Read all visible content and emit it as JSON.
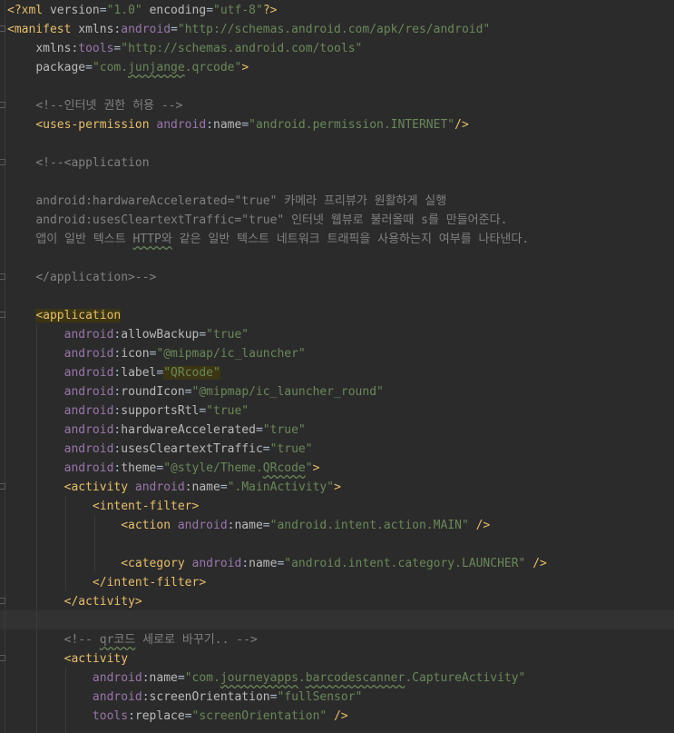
{
  "editor": {
    "language": "xml",
    "colors": {
      "background": "#2b2b2b",
      "tag": "#e8bf6a",
      "attribute": "#bababa",
      "namespace": "#9876aa",
      "string": "#6a8759",
      "comment": "#808080",
      "text": "#a9b7c6"
    },
    "lines": [
      [
        [
          "t-tag",
          "<?xml "
        ],
        [
          "t-attr",
          "version"
        ],
        [
          "t-plain",
          "="
        ],
        [
          "t-str",
          "\"1.0\""
        ],
        [
          "t-plain",
          " "
        ],
        [
          "t-attr",
          "encoding"
        ],
        [
          "t-plain",
          "="
        ],
        [
          "t-str",
          "\"utf-8\""
        ],
        [
          "t-tag",
          "?>"
        ]
      ],
      [
        [
          "t-tag",
          "<manifest "
        ],
        [
          "t-attr",
          "xmlns:"
        ],
        [
          "t-ns",
          "android"
        ],
        [
          "t-plain",
          "="
        ],
        [
          "t-str",
          "\"http://schemas.android.com/apk/res/android\""
        ]
      ],
      [
        [
          "t-plain",
          "    "
        ],
        [
          "t-attr",
          "xmlns:"
        ],
        [
          "t-ns",
          "tools"
        ],
        [
          "t-plain",
          "="
        ],
        [
          "t-str",
          "\"http://schemas.android.com/tools\""
        ]
      ],
      [
        [
          "t-plain",
          "    "
        ],
        [
          "t-attr",
          "package"
        ],
        [
          "t-plain",
          "="
        ],
        [
          "t-str",
          "\"com."
        ],
        [
          "t-str t-squig",
          "junjange"
        ],
        [
          "t-str",
          ".qrcode\""
        ],
        [
          "t-tag",
          ">"
        ]
      ],
      [],
      [
        [
          "t-plain",
          "    "
        ],
        [
          "t-cmt",
          "<!--인터넷 권한 허용 -->"
        ]
      ],
      [
        [
          "t-plain",
          "    "
        ],
        [
          "t-tag",
          "<uses-permission "
        ],
        [
          "t-ns",
          "android"
        ],
        [
          "t-plain",
          ":"
        ],
        [
          "t-attr",
          "name"
        ],
        [
          "t-plain",
          "="
        ],
        [
          "t-str",
          "\"android.permission.INTERNET\""
        ],
        [
          "t-tag",
          "/>"
        ]
      ],
      [],
      [
        [
          "t-plain",
          "    "
        ],
        [
          "t-cmt",
          "<!--<application"
        ]
      ],
      [],
      [
        [
          "t-plain",
          "    "
        ],
        [
          "t-cmt",
          "android:hardwareAccelerated=\"true\" 카메라 프리뷰가 원활하게 실행"
        ]
      ],
      [
        [
          "t-plain",
          "    "
        ],
        [
          "t-cmt",
          "android:usesCleartextTraffic=\"true\" 인터넷 웹뷰로 불러올때 s를 만들어준다."
        ]
      ],
      [
        [
          "t-plain",
          "    "
        ],
        [
          "t-cmt",
          "앱이 일반 텍스트 "
        ],
        [
          "t-cmt t-squig",
          "HTTP와"
        ],
        [
          "t-cmt",
          " 같은 일반 텍스트 네트워크 트래픽을 사용하는지 여부를 나타낸다."
        ]
      ],
      [],
      [
        [
          "t-plain",
          "    "
        ],
        [
          "t-cmt",
          "</application>-->"
        ]
      ],
      [],
      [
        [
          "t-plain",
          "    "
        ],
        [
          "t-tag t-hl",
          "<application"
        ]
      ],
      [
        [
          "t-plain",
          "        "
        ],
        [
          "t-ns",
          "android"
        ],
        [
          "t-plain",
          ":"
        ],
        [
          "t-attr",
          "allowBackup"
        ],
        [
          "t-plain",
          "="
        ],
        [
          "t-str",
          "\"true\""
        ]
      ],
      [
        [
          "t-plain",
          "        "
        ],
        [
          "t-ns",
          "android"
        ],
        [
          "t-plain",
          ":"
        ],
        [
          "t-attr",
          "icon"
        ],
        [
          "t-plain",
          "="
        ],
        [
          "t-str",
          "\"@mipmap/ic_launcher\""
        ]
      ],
      [
        [
          "t-plain",
          "        "
        ],
        [
          "t-ns",
          "android"
        ],
        [
          "t-plain",
          ":"
        ],
        [
          "t-attr",
          "label"
        ],
        [
          "t-plain",
          "="
        ],
        [
          "t-str t-hl",
          "\"QRcode\""
        ]
      ],
      [
        [
          "t-plain",
          "        "
        ],
        [
          "t-ns",
          "android"
        ],
        [
          "t-plain",
          ":"
        ],
        [
          "t-attr",
          "roundIcon"
        ],
        [
          "t-plain",
          "="
        ],
        [
          "t-str",
          "\"@mipmap/ic_launcher_round\""
        ]
      ],
      [
        [
          "t-plain",
          "        "
        ],
        [
          "t-ns",
          "android"
        ],
        [
          "t-plain",
          ":"
        ],
        [
          "t-attr",
          "supportsRtl"
        ],
        [
          "t-plain",
          "="
        ],
        [
          "t-str",
          "\"true\""
        ]
      ],
      [
        [
          "t-plain",
          "        "
        ],
        [
          "t-ns",
          "android"
        ],
        [
          "t-plain",
          ":"
        ],
        [
          "t-attr",
          "hardwareAccelerated"
        ],
        [
          "t-plain",
          "="
        ],
        [
          "t-str",
          "\"true\""
        ]
      ],
      [
        [
          "t-plain",
          "        "
        ],
        [
          "t-ns",
          "android"
        ],
        [
          "t-plain",
          ":"
        ],
        [
          "t-attr",
          "usesCleartextTraffic"
        ],
        [
          "t-plain",
          "="
        ],
        [
          "t-str",
          "\"true\""
        ]
      ],
      [
        [
          "t-plain",
          "        "
        ],
        [
          "t-ns",
          "android"
        ],
        [
          "t-plain",
          ":"
        ],
        [
          "t-attr",
          "theme"
        ],
        [
          "t-plain",
          "="
        ],
        [
          "t-str",
          "\"@style/Theme."
        ],
        [
          "t-str t-squig",
          "QRcode"
        ],
        [
          "t-str",
          "\""
        ],
        [
          "t-tag",
          ">"
        ]
      ],
      [
        [
          "t-plain",
          "        "
        ],
        [
          "t-tag",
          "<activity "
        ],
        [
          "t-ns",
          "android"
        ],
        [
          "t-plain",
          ":"
        ],
        [
          "t-attr",
          "name"
        ],
        [
          "t-plain",
          "="
        ],
        [
          "t-str",
          "\".MainActivity\""
        ],
        [
          "t-tag",
          ">"
        ]
      ],
      [
        [
          "t-plain",
          "            "
        ],
        [
          "t-tag",
          "<intent-filter>"
        ]
      ],
      [
        [
          "t-plain",
          "                "
        ],
        [
          "t-tag",
          "<action "
        ],
        [
          "t-ns",
          "android"
        ],
        [
          "t-plain",
          ":"
        ],
        [
          "t-attr",
          "name"
        ],
        [
          "t-plain",
          "="
        ],
        [
          "t-str",
          "\"android.intent.action.MAIN\""
        ],
        [
          "t-plain",
          " "
        ],
        [
          "t-tag",
          "/>"
        ]
      ],
      [],
      [
        [
          "t-plain",
          "                "
        ],
        [
          "t-tag",
          "<category "
        ],
        [
          "t-ns",
          "android"
        ],
        [
          "t-plain",
          ":"
        ],
        [
          "t-attr",
          "name"
        ],
        [
          "t-plain",
          "="
        ],
        [
          "t-str",
          "\"android.intent.category.LAUNCHER\""
        ],
        [
          "t-plain",
          " "
        ],
        [
          "t-tag",
          "/>"
        ]
      ],
      [
        [
          "t-plain",
          "            "
        ],
        [
          "t-tag",
          "</intent-filter>"
        ]
      ],
      [
        [
          "t-plain",
          "        "
        ],
        [
          "t-tag",
          "</activity>"
        ]
      ],
      [],
      [
        [
          "t-plain",
          "        "
        ],
        [
          "t-cmt",
          "<!-- "
        ],
        [
          "t-cmt t-squig",
          "qr코드"
        ],
        [
          "t-cmt",
          " 세로로 바꾸기.. -->"
        ]
      ],
      [
        [
          "t-plain",
          "        "
        ],
        [
          "t-tag",
          "<activity"
        ]
      ],
      [
        [
          "t-plain",
          "            "
        ],
        [
          "t-ns",
          "android"
        ],
        [
          "t-plain",
          ":"
        ],
        [
          "t-attr",
          "name"
        ],
        [
          "t-plain",
          "="
        ],
        [
          "t-str",
          "\"com."
        ],
        [
          "t-str t-squig",
          "journeyapps"
        ],
        [
          "t-str",
          "."
        ],
        [
          "t-str t-squig",
          "barcodescanner"
        ],
        [
          "t-str",
          ".CaptureActivity\""
        ]
      ],
      [
        [
          "t-plain",
          "            "
        ],
        [
          "t-ns",
          "android"
        ],
        [
          "t-plain",
          ":"
        ],
        [
          "t-attr",
          "screenOrientation"
        ],
        [
          "t-plain",
          "="
        ],
        [
          "t-str",
          "\"fullSensor\""
        ]
      ],
      [
        [
          "t-plain",
          "            "
        ],
        [
          "t-ns",
          "tools"
        ],
        [
          "t-plain",
          ":"
        ],
        [
          "t-attr",
          "replace"
        ],
        [
          "t-plain",
          "="
        ],
        [
          "t-str",
          "\"screenOrientation\""
        ],
        [
          "t-plain",
          " "
        ],
        [
          "t-tag",
          "/>"
        ]
      ]
    ]
  }
}
